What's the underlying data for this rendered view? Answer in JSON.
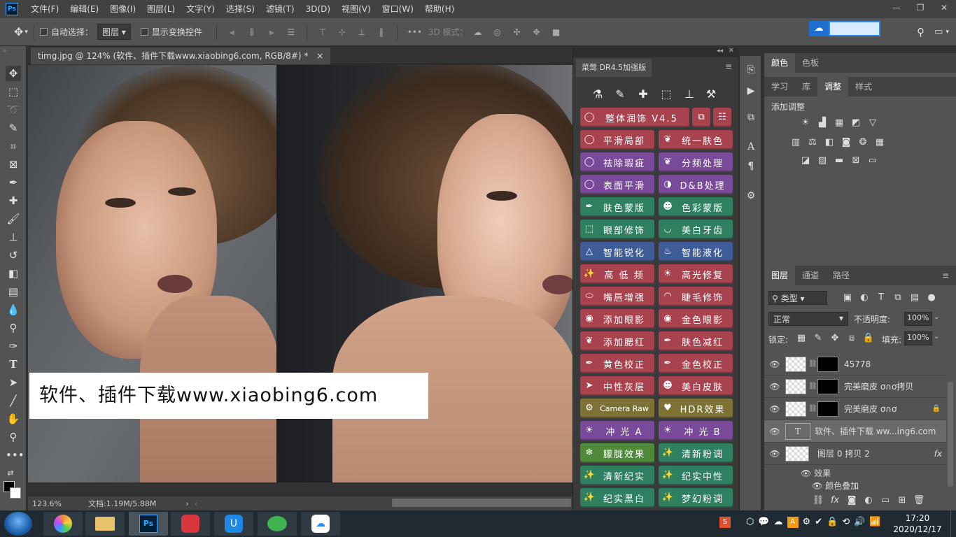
{
  "menubar": {
    "logo": "Ps",
    "items": [
      "文件(F)",
      "编辑(E)",
      "图像(I)",
      "图层(L)",
      "文字(Y)",
      "选择(S)",
      "滤镜(T)",
      "3D(D)",
      "视图(V)",
      "窗口(W)",
      "帮助(H)"
    ]
  },
  "window_controls": {
    "minimize": "—",
    "restore": "❐",
    "close": "✕"
  },
  "options": {
    "auto_select_label": "自动选择：",
    "auto_select_value": "图层",
    "show_transform_label": "显示变换控件",
    "mode_3d_label": "3D 模式："
  },
  "document": {
    "tab_title": "timg.jpg @ 124% (软件、插件下载www.xiaobing6.com, RGB/8#) *",
    "tab_close": "×",
    "watermark": "软件、插件下载www.xiaobing6.com",
    "zoom": "123.6%",
    "doc_size": "文档:1.19M/5.88M"
  },
  "plugin": {
    "title": "菜莺 DR4.5加强版",
    "main_button": "整体润饰 V4.5",
    "buttons": [
      {
        "label": "平滑局部",
        "color": "red",
        "icon": "lasso-icon"
      },
      {
        "label": "统一肤色",
        "color": "red",
        "icon": "leaf-icon"
      },
      {
        "label": "祛除瑕疵",
        "color": "purple",
        "icon": "lasso-icon"
      },
      {
        "label": "分频处理",
        "color": "purple",
        "icon": "leaf-icon"
      },
      {
        "label": "表面平滑",
        "color": "purple",
        "icon": "lasso-icon"
      },
      {
        "label": "D&B处理",
        "color": "purple",
        "icon": "contrast-icon"
      },
      {
        "label": "肤色蒙版",
        "color": "green",
        "icon": "dropper-icon"
      },
      {
        "label": "色彩蒙版",
        "color": "green",
        "icon": "mask-icon"
      },
      {
        "label": "眼部修饰",
        "color": "green",
        "icon": "select-icon"
      },
      {
        "label": "美白牙齿",
        "color": "green",
        "icon": "smile-icon"
      },
      {
        "label": "智能锐化",
        "color": "blue",
        "icon": "triangle-icon"
      },
      {
        "label": "智能液化",
        "color": "blue",
        "icon": "drop-icon"
      },
      {
        "label": "高 低 频",
        "color": "red",
        "icon": "wand-icon"
      },
      {
        "label": "高光修复",
        "color": "red",
        "icon": "sun-icon"
      },
      {
        "label": "嘴唇增强",
        "color": "red",
        "icon": "lips-icon"
      },
      {
        "label": "睫毛修饰",
        "color": "red",
        "icon": "lash-icon"
      },
      {
        "label": "添加眼影",
        "color": "red",
        "icon": "eye-icon"
      },
      {
        "label": "金色眼影",
        "color": "red",
        "icon": "eye-icon"
      },
      {
        "label": "添加腮红",
        "color": "red",
        "icon": "leaf-icon"
      },
      {
        "label": "肤色减红",
        "color": "red",
        "icon": "dropper-icon"
      },
      {
        "label": "黄色校正",
        "color": "red",
        "icon": "dropper-icon"
      },
      {
        "label": "金色校正",
        "color": "red",
        "icon": "dropper-icon"
      },
      {
        "label": "中性灰层",
        "color": "red",
        "icon": "cursor-icon"
      },
      {
        "label": "美白皮肤",
        "color": "red",
        "icon": "mask-icon"
      },
      {
        "label": "Camera Raw",
        "color": "olive",
        "icon": "gear-icon"
      },
      {
        "label": "HDR效果",
        "color": "olive",
        "icon": "heart-icon"
      },
      {
        "label": "冲 光 A",
        "color": "purple",
        "icon": "sun-icon"
      },
      {
        "label": "冲 光 B",
        "color": "purple",
        "icon": "sun-icon"
      },
      {
        "label": "朦胧效果",
        "color": "lgreen",
        "icon": "snow-icon"
      },
      {
        "label": "清新粉调",
        "color": "green",
        "icon": "wand-icon"
      },
      {
        "label": "清新纪实",
        "color": "green",
        "icon": "wand-icon"
      },
      {
        "label": "纪实中性",
        "color": "green",
        "icon": "wand-icon"
      },
      {
        "label": "纪实黑白",
        "color": "green",
        "icon": "wand-icon"
      },
      {
        "label": "梦幻粉调",
        "color": "green",
        "icon": "wand-icon"
      }
    ]
  },
  "right_panel": {
    "color_tabs": [
      "颜色",
      "色板"
    ],
    "adj_tabs": [
      "学习",
      "库",
      "调整",
      "样式"
    ],
    "adj_title": "添加调整",
    "layer_tabs": [
      "图层",
      "通道",
      "路径"
    ],
    "filter_kind": "类型",
    "blend_mode": "正常",
    "opacity_label": "不透明度:",
    "opacity_value": "100%",
    "lock_label": "锁定:",
    "fill_label": "填充:",
    "fill_value": "100%",
    "layers": [
      {
        "name": "45778",
        "type": "masked"
      },
      {
        "name": "完美磨皮 ơ∩ơ拷贝",
        "type": "masked"
      },
      {
        "name": "完美磨皮 ơ∩ơ",
        "type": "masked"
      },
      {
        "name": "软件、插件下载 ww...ing6.com",
        "type": "text"
      },
      {
        "name": "图层 0 拷贝 2",
        "type": "pixel",
        "fx": "fx"
      }
    ],
    "effects_label": "效果",
    "effect_item": "颜色叠加"
  },
  "taskbar": {
    "time": "17:20",
    "date": "2020/12/17"
  },
  "colors": {
    "accent": "#31a8ff",
    "panel": "#535353",
    "dark": "#323232"
  }
}
